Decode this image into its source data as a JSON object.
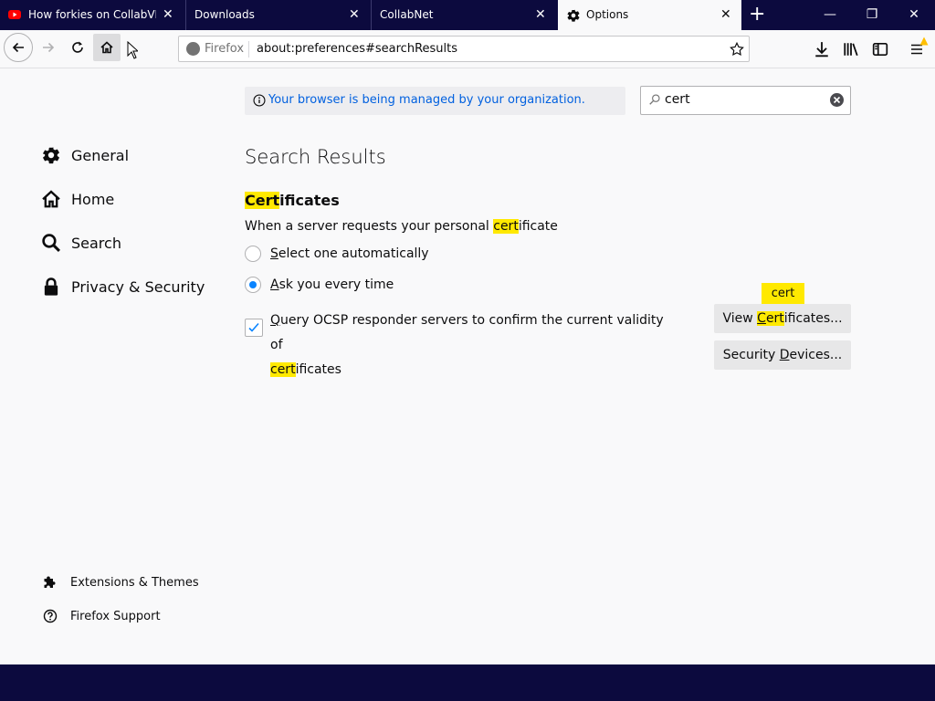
{
  "tabs": [
    {
      "title": "How forkies on CollabVM a",
      "icon": "youtube-icon",
      "active": false
    },
    {
      "title": "Downloads",
      "icon": "",
      "active": false
    },
    {
      "title": "CollabNet",
      "icon": "",
      "active": false
    },
    {
      "title": "Options",
      "icon": "gear-icon",
      "active": true
    }
  ],
  "tab_close_glyph": "✕",
  "new_tab_glyph": "+",
  "window_controls": {
    "minimize": "—",
    "restore": "❐",
    "close": "✕"
  },
  "urlbar": {
    "identity_label": "Firefox",
    "url": "about:preferences#searchResults"
  },
  "notice": {
    "text": "Your browser is being managed by your organization."
  },
  "search": {
    "value": "cert"
  },
  "sidebar": {
    "categories": [
      {
        "label": "General",
        "icon": "gear-icon"
      },
      {
        "label": "Home",
        "icon": "home-icon"
      },
      {
        "label": "Search",
        "icon": "magnifier-icon"
      },
      {
        "label": "Privacy & Security",
        "icon": "lock-icon"
      }
    ],
    "footer": [
      {
        "label": "Extensions & Themes",
        "icon": "puzzle-icon"
      },
      {
        "label": "Firefox Support",
        "icon": "help-icon"
      }
    ]
  },
  "main": {
    "heading": "Search Results",
    "section": {
      "title_hl": "Cert",
      "title_rest": "ificates"
    },
    "description": {
      "pre": "When a server requests your personal ",
      "hl": "cert",
      "post": "ificate"
    },
    "radios": [
      {
        "accesskey": "S",
        "rest": "elect one automatically",
        "checked": false
      },
      {
        "accesskey": "A",
        "rest": "sk you every time",
        "checked": true
      }
    ],
    "checkbox": {
      "accesskey": "Q",
      "line1_rest": "uery OCSP responder servers to confirm the current validity of",
      "line2_hl": "cert",
      "line2_rest": "ificates",
      "checked": true
    },
    "tooltip": "cert",
    "buttons": {
      "view": {
        "pre": "View ",
        "accesskey_hl": "C",
        "hl_rest": "ert",
        "post": "ificates..."
      },
      "security": {
        "pre": "Security ",
        "accesskey": "D",
        "post": "evices..."
      }
    }
  },
  "colors": {
    "highlight": "#ffe900",
    "accent": "#0a84ff",
    "titlebar": "#0c0a3e",
    "notice_text": "#0060df"
  }
}
